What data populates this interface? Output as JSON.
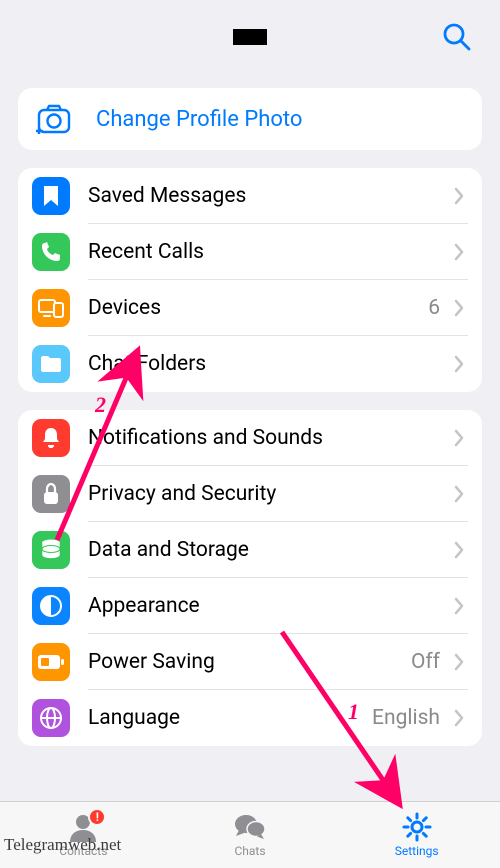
{
  "header": {
    "title_redacted": true
  },
  "profile": {
    "change_photo_label": "Change Profile Photo"
  },
  "group1": [
    {
      "key": "saved",
      "label": "Saved Messages",
      "icon": "bookmark-icon",
      "color": "bg-blue"
    },
    {
      "key": "calls",
      "label": "Recent Calls",
      "icon": "phone-icon",
      "color": "bg-green"
    },
    {
      "key": "devices",
      "label": "Devices",
      "icon": "devices-icon",
      "color": "bg-orange",
      "value": "6"
    },
    {
      "key": "folders",
      "label": "Chat Folders",
      "icon": "folder-icon",
      "color": "bg-teal"
    }
  ],
  "group2": [
    {
      "key": "notif",
      "label": "Notifications and Sounds",
      "icon": "bell-icon",
      "color": "bg-red"
    },
    {
      "key": "privacy",
      "label": "Privacy and Security",
      "icon": "lock-icon",
      "color": "bg-gray"
    },
    {
      "key": "data",
      "label": "Data and Storage",
      "icon": "database-icon",
      "color": "bg-green"
    },
    {
      "key": "appear",
      "label": "Appearance",
      "icon": "contrast-icon",
      "color": "bg-darkblue"
    },
    {
      "key": "power",
      "label": "Power Saving",
      "icon": "battery-icon",
      "color": "bg-orange",
      "value": "Off"
    },
    {
      "key": "lang",
      "label": "Language",
      "icon": "globe-icon",
      "color": "bg-purple",
      "value": "English"
    }
  ],
  "tabs": {
    "contacts": {
      "label": "Contacts",
      "badge": "!"
    },
    "chats": {
      "label": "Chats"
    },
    "settings": {
      "label": "Settings",
      "active": true
    }
  },
  "annotations": {
    "num1": "1",
    "num2": "2",
    "watermark": "Telegramweb.net"
  }
}
